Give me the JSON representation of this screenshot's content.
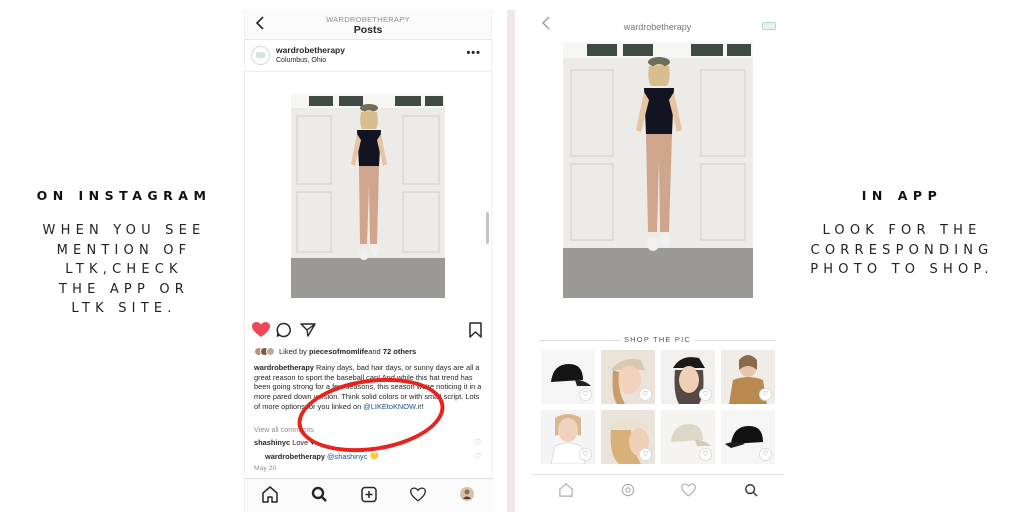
{
  "left_caption": {
    "heading": "ON INSTAGRAM",
    "lines": [
      "WHEN YOU SEE",
      "MENTION OF",
      "LTK,CHECK",
      "THE APP OR",
      "LTK SITE."
    ]
  },
  "right_caption": {
    "heading": "IN APP",
    "lines": [
      "LOOK FOR THE",
      "CORRESPONDING",
      "PHOTO TO SHOP."
    ]
  },
  "instagram": {
    "top_username": "WARDROBETHERAPY",
    "top_title": "Posts",
    "back_icon": "chevron-left-icon",
    "post_username": "wardrobetherapy",
    "post_location": "Columbus, Ohio",
    "more_label": "•••",
    "liked_by_prefix": "Liked by ",
    "liked_by_user": "piecesofmomlife",
    "liked_by_and": " and ",
    "liked_by_count": "72 others",
    "caption_user": "wardrobetherapy",
    "caption_text": " Rainy days, bad hair days, or sunny days are all a great reason to sport the baseball cap! And while this hat trend has been going strong for a few seasons, this season we're noticing it in a more pared down version. Think solid colors or with small script. Lots of more options for you linked on ",
    "caption_link": "@LIKEtoKNOW.it",
    "caption_end": "!",
    "view_all": "View all comments",
    "comment1_user": "shashinyc",
    "comment1_text": " Love ♥",
    "comment2_user": "wardrobetherapy",
    "comment2_mention": " @shashinyc",
    "comment2_emoji": " 💛",
    "date": "May 20",
    "like_color": "#ed4956",
    "highlight_color": "#e8231c"
  },
  "app": {
    "username": "wardrobetherapy",
    "shop_label": "SHOP THE PIC",
    "products": [
      {
        "name": "black-cap",
        "heart": "♡"
      },
      {
        "name": "model-beige-cap",
        "heart": "♡"
      },
      {
        "name": "model-black-cap",
        "heart": "♡"
      },
      {
        "name": "model-trench",
        "heart": "♡"
      },
      {
        "name": "model-white-top",
        "heart": "♡"
      },
      {
        "name": "model-cap-profile",
        "heart": "♡"
      },
      {
        "name": "beige-cap",
        "heart": "♡"
      },
      {
        "name": "black-cap-2",
        "heart": "♡"
      }
    ]
  }
}
